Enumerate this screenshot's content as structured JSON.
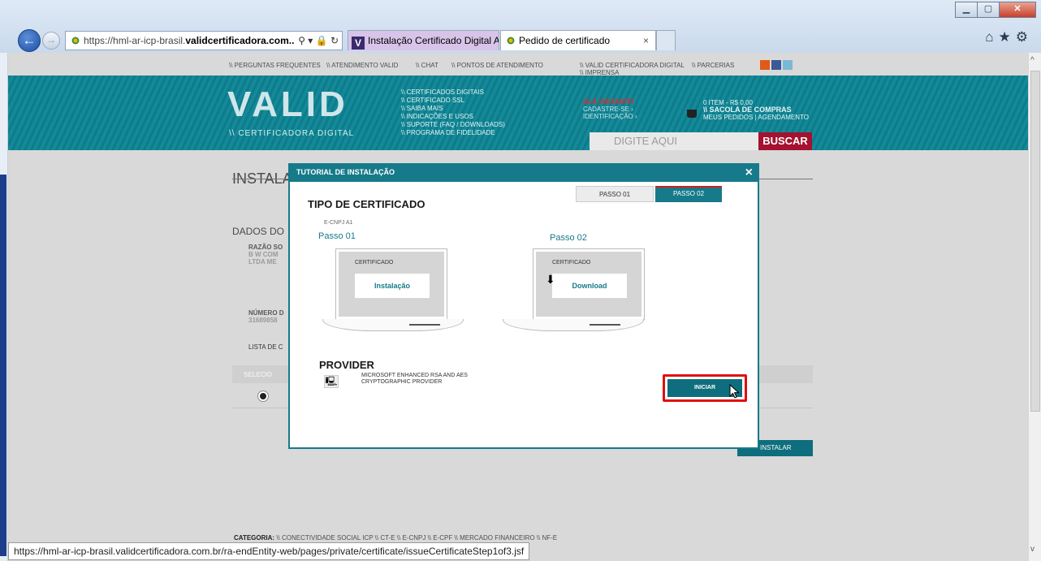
{
  "browser": {
    "address_prefix": "https://hml-ar-icp-brasil.",
    "address_domain": "validcertificadora.com....",
    "address_tools": "⚲ ▾ 🔒 ↻",
    "tabs": [
      {
        "label": "Instalação Certificado Digital A1"
      },
      {
        "label": "Pedido de certificado",
        "close": "×"
      }
    ],
    "status_url": "https://hml-ar-icp-brasil.validcertificadora.com.br/ra-endEntity-web/pages/private/certificate/issueCertificateStep1of3.jsf"
  },
  "topnav": {
    "items": [
      "\\\\ PERGUNTAS FREQUENTES",
      "\\\\ ATENDIMENTO VALID",
      "\\\\ CHAT",
      "\\\\ PONTOS DE ATENDIMENTO",
      "\\\\ VALID CERTIFICADORA DIGITAL",
      "\\\\ PARCERIAS",
      "\\\\ IMPRENSA"
    ]
  },
  "header": {
    "logo": "VALID",
    "logo_sub": "\\\\ CERTIFICADORA DIGITAL",
    "menu": [
      "\\\\ CERTIFICADOS DIGITAIS",
      "\\\\ CERTIFICADO SSL",
      "\\\\ SAIBA MAIS",
      "\\\\ INDICAÇÕES E USOS",
      "\\\\ SUPORTE (FAQ / DOWNLOADS)",
      "\\\\ PROGRAMA DE FIDELIDADE"
    ],
    "greeting": "OLÁ VISITANTE!",
    "signup": "CADASTRE-SE ›",
    "login": "IDENTIFICAÇÃO ›",
    "cart_count": "0 ITEM - R$ 0,00",
    "cart_label": "\\\\ SACOLA DE COMPRAS",
    "cart_links": "MEUS PEDIDOS | AGENDAMENTO",
    "search_placeholder": "DIGITE AQUI",
    "search_button": "BUSCAR"
  },
  "content": {
    "title": "INSTALAÇ",
    "section": "DADOS DO",
    "razao_label": "RAZÃO SO",
    "razao_value_1": "B W COM",
    "razao_value_2": "LTDA ME",
    "numero_label": "NÚMERO D",
    "numero_value": "31689858",
    "lista_label": "LISTA DE C",
    "table_header": "SELECIO",
    "install_button": "INSTALAR",
    "category_label": "CATEGORIA:",
    "categories": "\\\\ CONECTIVIDADE SOCIAL ICP   \\\\ CT-E   \\\\ E-CNPJ   \\\\ E-CPF   \\\\ MERCADO FINANCEIRO   \\\\ NF-E"
  },
  "modal": {
    "title": "TUTORIAL DE INSTALAÇÃO",
    "close": "×",
    "step1_tab": "PASSO 01",
    "step2_tab": "PASSO 02",
    "heading": "TIPO DE CERTIFICADO",
    "cert_type": "E-CNPJ A1",
    "passo1": "Passo 01",
    "passo2": "Passo 02",
    "cert_caption": "CERTIFICADO",
    "install_label": "Instalação",
    "download_label": "Download",
    "provider_heading": "PROVIDER",
    "provider_line1": "MICROSOFT ENHANCED RSA AND AES",
    "provider_line2": "CRYPTOGRAPHIC PROVIDER",
    "start_button": "INICIAR"
  },
  "colors": {
    "teal": "#167a8a",
    "brand_red": "#a4122f",
    "highlight": "#e10e0e"
  }
}
